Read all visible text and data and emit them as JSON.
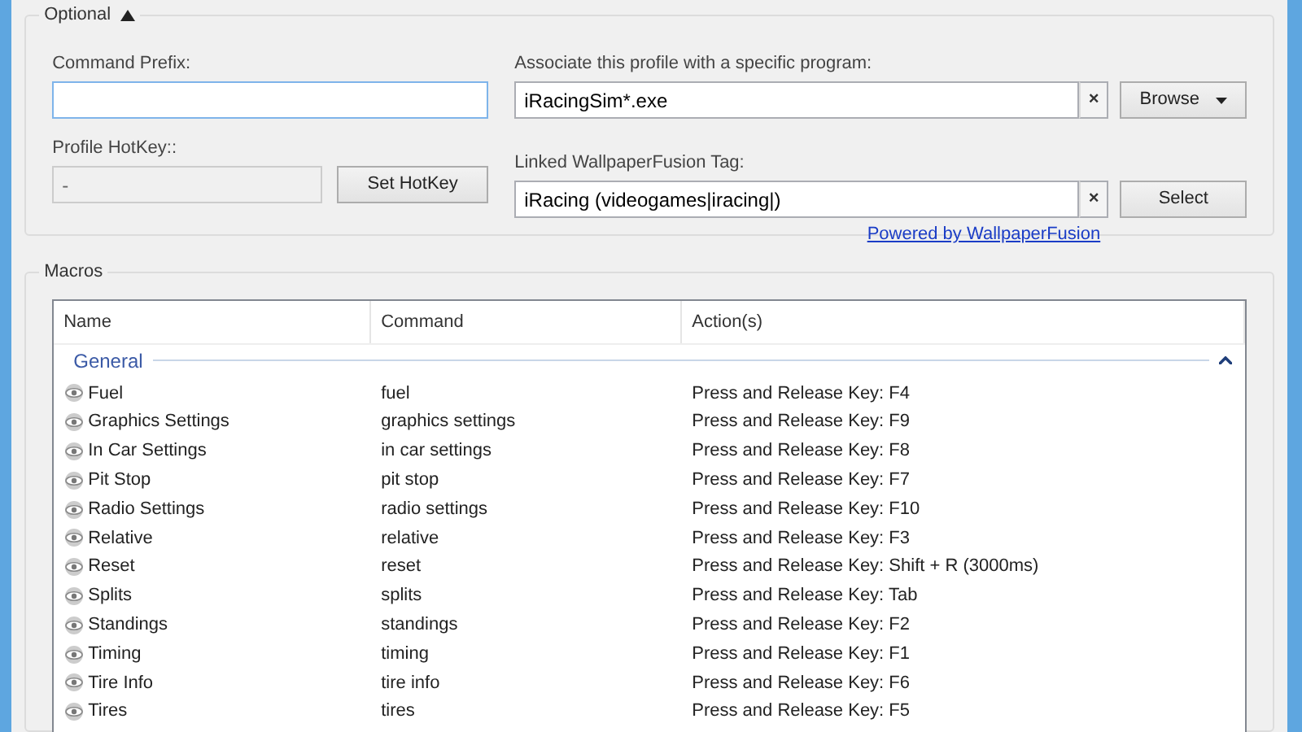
{
  "optional": {
    "title": "Optional",
    "expanded": true,
    "command_prefix": {
      "label": "Command Prefix:"
    },
    "profile_hotkey": {
      "label": "Profile HotKey::",
      "value": "-",
      "disabled": true,
      "button": "Set HotKey"
    },
    "program": {
      "label": "Associate this profile with a specific program:",
      "value": "iRacingSim*.exe",
      "clear": "×",
      "button": "Browse"
    },
    "wallpaper_tag": {
      "label": "Linked WallpaperFusion Tag:",
      "value": "iRacing (videogames|iracing|)",
      "clear": "×",
      "button": "Select"
    },
    "link": "Powered by WallpaperFusion"
  },
  "macros": {
    "title": "Macros",
    "columns": [
      "Name",
      "Command",
      "Action(s)"
    ],
    "group": {
      "title": "General",
      "expanded": true
    },
    "rows": [
      {
        "name": "Fuel",
        "command": "fuel",
        "action": "Press and Release Key: F4"
      },
      {
        "name": "Graphics Settings",
        "command": "graphics settings",
        "action": "Press and Release Key: F9"
      },
      {
        "name": "In Car Settings",
        "command": "in car settings",
        "action": "Press and Release Key: F8"
      },
      {
        "name": "Pit Stop",
        "command": "pit stop",
        "action": "Press and Release Key: F7"
      },
      {
        "name": "Radio Settings",
        "command": "radio settings",
        "action": "Press and Release Key: F10"
      },
      {
        "name": "Relative",
        "command": "relative",
        "action": "Press and Release Key: F3"
      },
      {
        "name": "Reset",
        "command": "reset",
        "action": "Press and Release Key: Shift + R (3000ms)"
      },
      {
        "name": "Splits",
        "command": "splits",
        "action": "Press and Release Key: Tab"
      },
      {
        "name": "Standings",
        "command": "standings",
        "action": "Press and Release Key: F2"
      },
      {
        "name": "Timing",
        "command": "timing",
        "action": "Press and Release Key: F1"
      },
      {
        "name": "Tire Info",
        "command": "tire info",
        "action": "Press and Release Key: F6"
      },
      {
        "name": "Tires",
        "command": "tires",
        "action": "Press and Release Key: F5"
      }
    ]
  }
}
